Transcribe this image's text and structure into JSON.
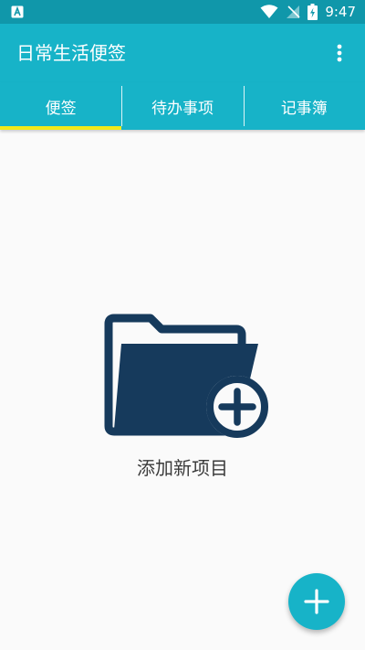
{
  "status_bar": {
    "time": "9:47",
    "icons": [
      "app-notification-icon",
      "wifi-icon",
      "no-signal-icon",
      "battery-charging-icon"
    ]
  },
  "app_bar": {
    "title": "日常生活便签",
    "menu_icon": "more-vert-icon"
  },
  "tabs": [
    {
      "label": "便签",
      "selected": true
    },
    {
      "label": "待办事项",
      "selected": false
    },
    {
      "label": "记事簿",
      "selected": false
    }
  ],
  "empty_state": {
    "icon": "folder-add-icon",
    "label": "添加新项目"
  },
  "fab": {
    "icon": "plus-icon"
  },
  "colors": {
    "status_bar": "#1097aa",
    "primary": "#17b3c8",
    "tab_indicator": "#f2ea1a",
    "folder": "#163a5c",
    "background": "#fafafa"
  }
}
